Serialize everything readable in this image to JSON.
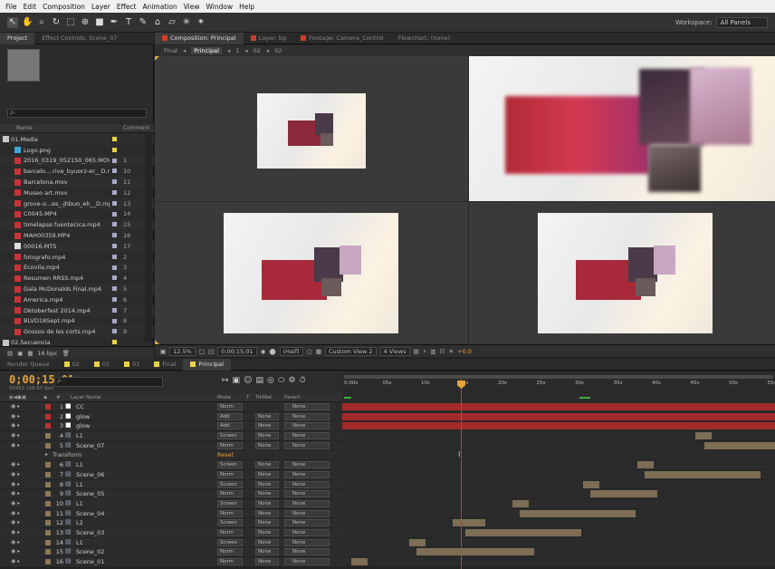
{
  "menu": [
    "File",
    "Edit",
    "Composition",
    "Layer",
    "Effect",
    "Animation",
    "View",
    "Window",
    "Help"
  ],
  "toolbar": {
    "tools": [
      "select-tool",
      "hand-tool",
      "zoom-tool",
      "rotate-tool",
      "camera-tool",
      "pan-behind-tool",
      "mask-tool",
      "pen-tool",
      "type-tool",
      "brush-tool",
      "clone-tool",
      "eraser-tool",
      "roto-brush-tool",
      "puppet-tool"
    ],
    "workspace_label": "Workspace:",
    "workspace_value": "All Panels"
  },
  "project_panel": {
    "tabs": [
      "Project",
      "Effect Controls: Scene_07"
    ],
    "search_placeholder": "ρ‑",
    "col_name": "Name",
    "col_comment": "Comment",
    "items": [
      {
        "type": "folder",
        "name": "01.Media",
        "label_color": "#e6d24a",
        "comment": ""
      },
      {
        "type": "png",
        "name": "Logo.png",
        "label_color": "#e6d24a",
        "comment": ""
      },
      {
        "type": "video",
        "name": "2016_0319_052150_065.MOV",
        "label_color": "#a8a8c8",
        "comment": "1"
      },
      {
        "type": "video",
        "name": "barcelo....rive_byuorz-er__D.mp4",
        "label_color": "#a8a8c8",
        "comment": "10"
      },
      {
        "type": "video",
        "name": "Barcelona.mov",
        "label_color": "#a8a8c8",
        "comment": "11"
      },
      {
        "type": "video",
        "name": "Museo art.mov",
        "label_color": "#a8a8c8",
        "comment": "12"
      },
      {
        "type": "video",
        "name": "grove-o...es_-jhbuo_eh__D.mp4",
        "label_color": "#a8a8c8",
        "comment": "13"
      },
      {
        "type": "video",
        "name": "C0045.MP4",
        "label_color": "#a8a8c8",
        "comment": "14"
      },
      {
        "type": "video",
        "name": "timelapse fuentecica.mp4",
        "label_color": "#a8a8c8",
        "comment": "15"
      },
      {
        "type": "video",
        "name": "MAH00359.MP4",
        "label_color": "#a8a8c8",
        "comment": "16"
      },
      {
        "type": "mts",
        "name": "00016.MTS",
        "label_color": "#a8a8c8",
        "comment": "17"
      },
      {
        "type": "video",
        "name": "fotografo.mp4",
        "label_color": "#a8a8c8",
        "comment": "2"
      },
      {
        "type": "video",
        "name": "Ecovila.mp4",
        "label_color": "#a8a8c8",
        "comment": "3"
      },
      {
        "type": "video",
        "name": "Resumen RRSS.mp4",
        "label_color": "#a8a8c8",
        "comment": "4"
      },
      {
        "type": "video",
        "name": "Gala McDonalds Final.mp4",
        "label_color": "#a8a8c8",
        "comment": "5"
      },
      {
        "type": "video",
        "name": "America.mp4",
        "label_color": "#a8a8c8",
        "comment": "6"
      },
      {
        "type": "video",
        "name": "Oktoberfest 2014.mp4",
        "label_color": "#a8a8c8",
        "comment": "7"
      },
      {
        "type": "video",
        "name": "BLVD18Sept.mp4",
        "label_color": "#a8a8c8",
        "comment": "8"
      },
      {
        "type": "video",
        "name": "Gossos de les corts.mp4",
        "label_color": "#a8a8c8",
        "comment": "9"
      },
      {
        "type": "folder",
        "name": "02.Secuencia",
        "label_color": "#e6d24a",
        "comment": ""
      }
    ],
    "footer_bpc": "16 bpc"
  },
  "viewer": {
    "tabs": [
      {
        "label": "Composition: Principal",
        "color": "#d23a2a",
        "active": true
      },
      {
        "label": "Layer: bg",
        "color": "#d23a2a",
        "active": false
      },
      {
        "label": "Footage: Camera_Control",
        "color": "#d23a2a",
        "active": false
      },
      {
        "label": "Flowchart: (none)",
        "color": "",
        "active": false
      }
    ],
    "breadcrumbs": [
      "Final",
      "Principal",
      "1",
      "02",
      "02"
    ],
    "footer": {
      "zoom": "12.5%",
      "timecode": "0;00;15;01",
      "resolution": "(Half)",
      "view": "Custom View 2",
      "views": "4 Views",
      "exposure": "+0,0"
    }
  },
  "timeline": {
    "tabs": [
      {
        "label": "Render Queue",
        "color": "",
        "active": false
      },
      {
        "label": "02",
        "color": "#e6d24a",
        "active": false
      },
      {
        "label": "01",
        "color": "#e6d24a",
        "active": false
      },
      {
        "label": "01",
        "color": "#e6d24a",
        "active": false
      },
      {
        "label": "Final",
        "color": "#e6d24a",
        "active": false
      },
      {
        "label": "Principal",
        "color": "#e6d24a",
        "active": true
      }
    ],
    "timecode": "0;00;15;01",
    "fps": "00451 (29.97 fps)",
    "search_placeholder": "ρ‑",
    "ruler_ticks": [
      "0:00s",
      "05s",
      "10s",
      "15s",
      "20s",
      "25s",
      "30s",
      "35s",
      "40s",
      "45s",
      "50s",
      "55s"
    ],
    "columns": {
      "name": "Layer Name",
      "mode": "Mode",
      "t": "T",
      "trkmat": "TrkMat",
      "parent": "Parent"
    },
    "layers": [
      {
        "num": "1",
        "name": "CC",
        "mode": "Norm",
        "trk": "",
        "parent": "None",
        "color": "#c02e2e",
        "icon": "solid"
      },
      {
        "num": "2",
        "name": "glow",
        "mode": "Add",
        "trk": "None",
        "parent": "None",
        "color": "#c02e2e",
        "icon": "solid"
      },
      {
        "num": "3",
        "name": "glow",
        "mode": "Add",
        "trk": "None",
        "parent": "None",
        "color": "#c02e2e",
        "icon": "solid"
      },
      {
        "num": "4",
        "name": "L1",
        "mode": "Screen",
        "trk": "None",
        "parent": "None",
        "color": "#8c7a58",
        "icon": "comp"
      },
      {
        "num": "5",
        "name": "Scene_07",
        "mode": "Norm",
        "trk": "None",
        "parent": "None",
        "color": "#8c7a58",
        "icon": "comp"
      },
      {
        "sub": true,
        "name": "Transform",
        "value": "Reset"
      },
      {
        "num": "6",
        "name": "L1",
        "mode": "Screen",
        "trk": "None",
        "parent": "None",
        "color": "#8c7a58",
        "icon": "comp"
      },
      {
        "num": "7",
        "name": "Scene_06",
        "mode": "Norm",
        "trk": "None",
        "parent": "None",
        "color": "#8c7a58",
        "icon": "comp"
      },
      {
        "num": "8",
        "name": "L1",
        "mode": "Screen",
        "trk": "None",
        "parent": "None",
        "color": "#8c7a58",
        "icon": "comp"
      },
      {
        "num": "9",
        "name": "Scene_05",
        "mode": "Norm",
        "trk": "None",
        "parent": "None",
        "color": "#8c7a58",
        "icon": "comp"
      },
      {
        "num": "10",
        "name": "L1",
        "mode": "Screen",
        "trk": "None",
        "parent": "None",
        "color": "#8c7a58",
        "icon": "comp"
      },
      {
        "num": "11",
        "name": "Scene_04",
        "mode": "Norm",
        "trk": "None",
        "parent": "None",
        "color": "#8c7a58",
        "icon": "comp"
      },
      {
        "num": "12",
        "name": "L2",
        "mode": "Screen",
        "trk": "None",
        "parent": "None",
        "color": "#8c7a58",
        "icon": "comp"
      },
      {
        "num": "13",
        "name": "Scene_03",
        "mode": "Norm",
        "trk": "None",
        "parent": "None",
        "color": "#8c7a58",
        "icon": "comp"
      },
      {
        "num": "14",
        "name": "L1",
        "mode": "Screen",
        "trk": "None",
        "parent": "None",
        "color": "#8c7a58",
        "icon": "comp"
      },
      {
        "num": "15",
        "name": "Scene_02",
        "mode": "Norm",
        "trk": "None",
        "parent": "None",
        "color": "#8c7a58",
        "icon": "comp"
      },
      {
        "num": "16",
        "name": "Scene_01",
        "mode": "Norm",
        "trk": "None",
        "parent": "None",
        "color": "#8c7a58",
        "icon": "comp"
      }
    ],
    "colors": {
      "playhead": "#d23a2a",
      "timecode": "#e8a33b",
      "solid_bar": "#a32a2a",
      "comp_bar": "#7d6e55"
    }
  }
}
